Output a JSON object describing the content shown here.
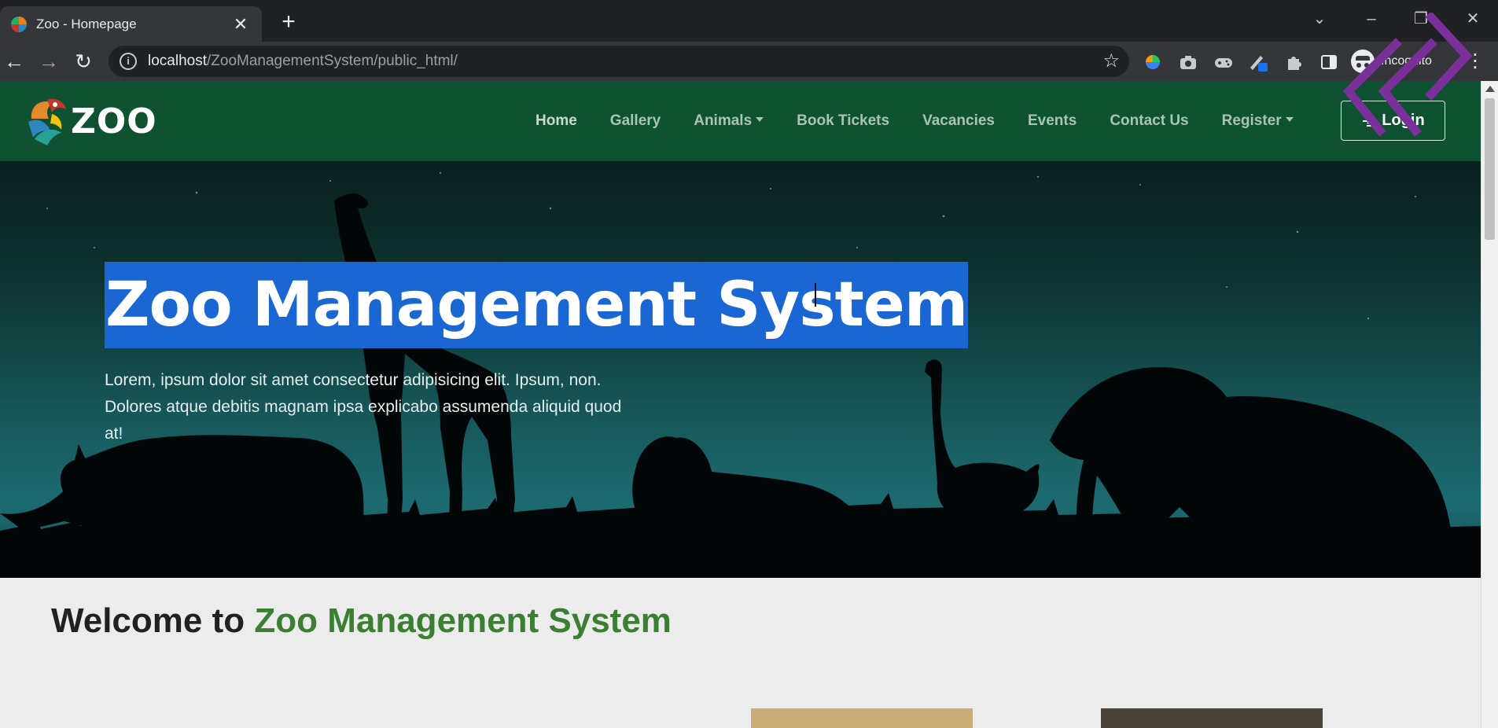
{
  "browser": {
    "tab_title": "Zoo - Homepage",
    "tab_close": "✕",
    "new_tab": "+",
    "url_host": "localhost",
    "url_path": "/ZooManagementSystem/public_html/",
    "profile_label": "Incognito",
    "icons": [
      "back-arrow-icon",
      "forward-arrow-icon",
      "reload-icon",
      "info-icon",
      "star-icon",
      "extension-icons",
      "puzzle-icon",
      "sidebar-icon",
      "incognito-icon",
      "menu-dots-icon"
    ]
  },
  "navbar": {
    "logo_text": "ZOO",
    "links": [
      "Home",
      "Gallery",
      "Animals",
      "Book Tickets",
      "Vacancies",
      "Events",
      "Contact Us",
      "Register"
    ],
    "login_label": "Login"
  },
  "hero": {
    "title": "Zoo Management System",
    "text": "Lorem, ipsum dolor sit amet consectetur adipisicing elit. Ipsum, non. Dolores atque debitis magnam ipsa explicabo assumenda aliquid quod at!"
  },
  "welcome": {
    "prefix": "Welcome to ",
    "accent": "Zoo Management System"
  },
  "colors": {
    "navbar": "#0e5231",
    "accent_green": "#3b7f32",
    "selection": "#1a66d2"
  }
}
